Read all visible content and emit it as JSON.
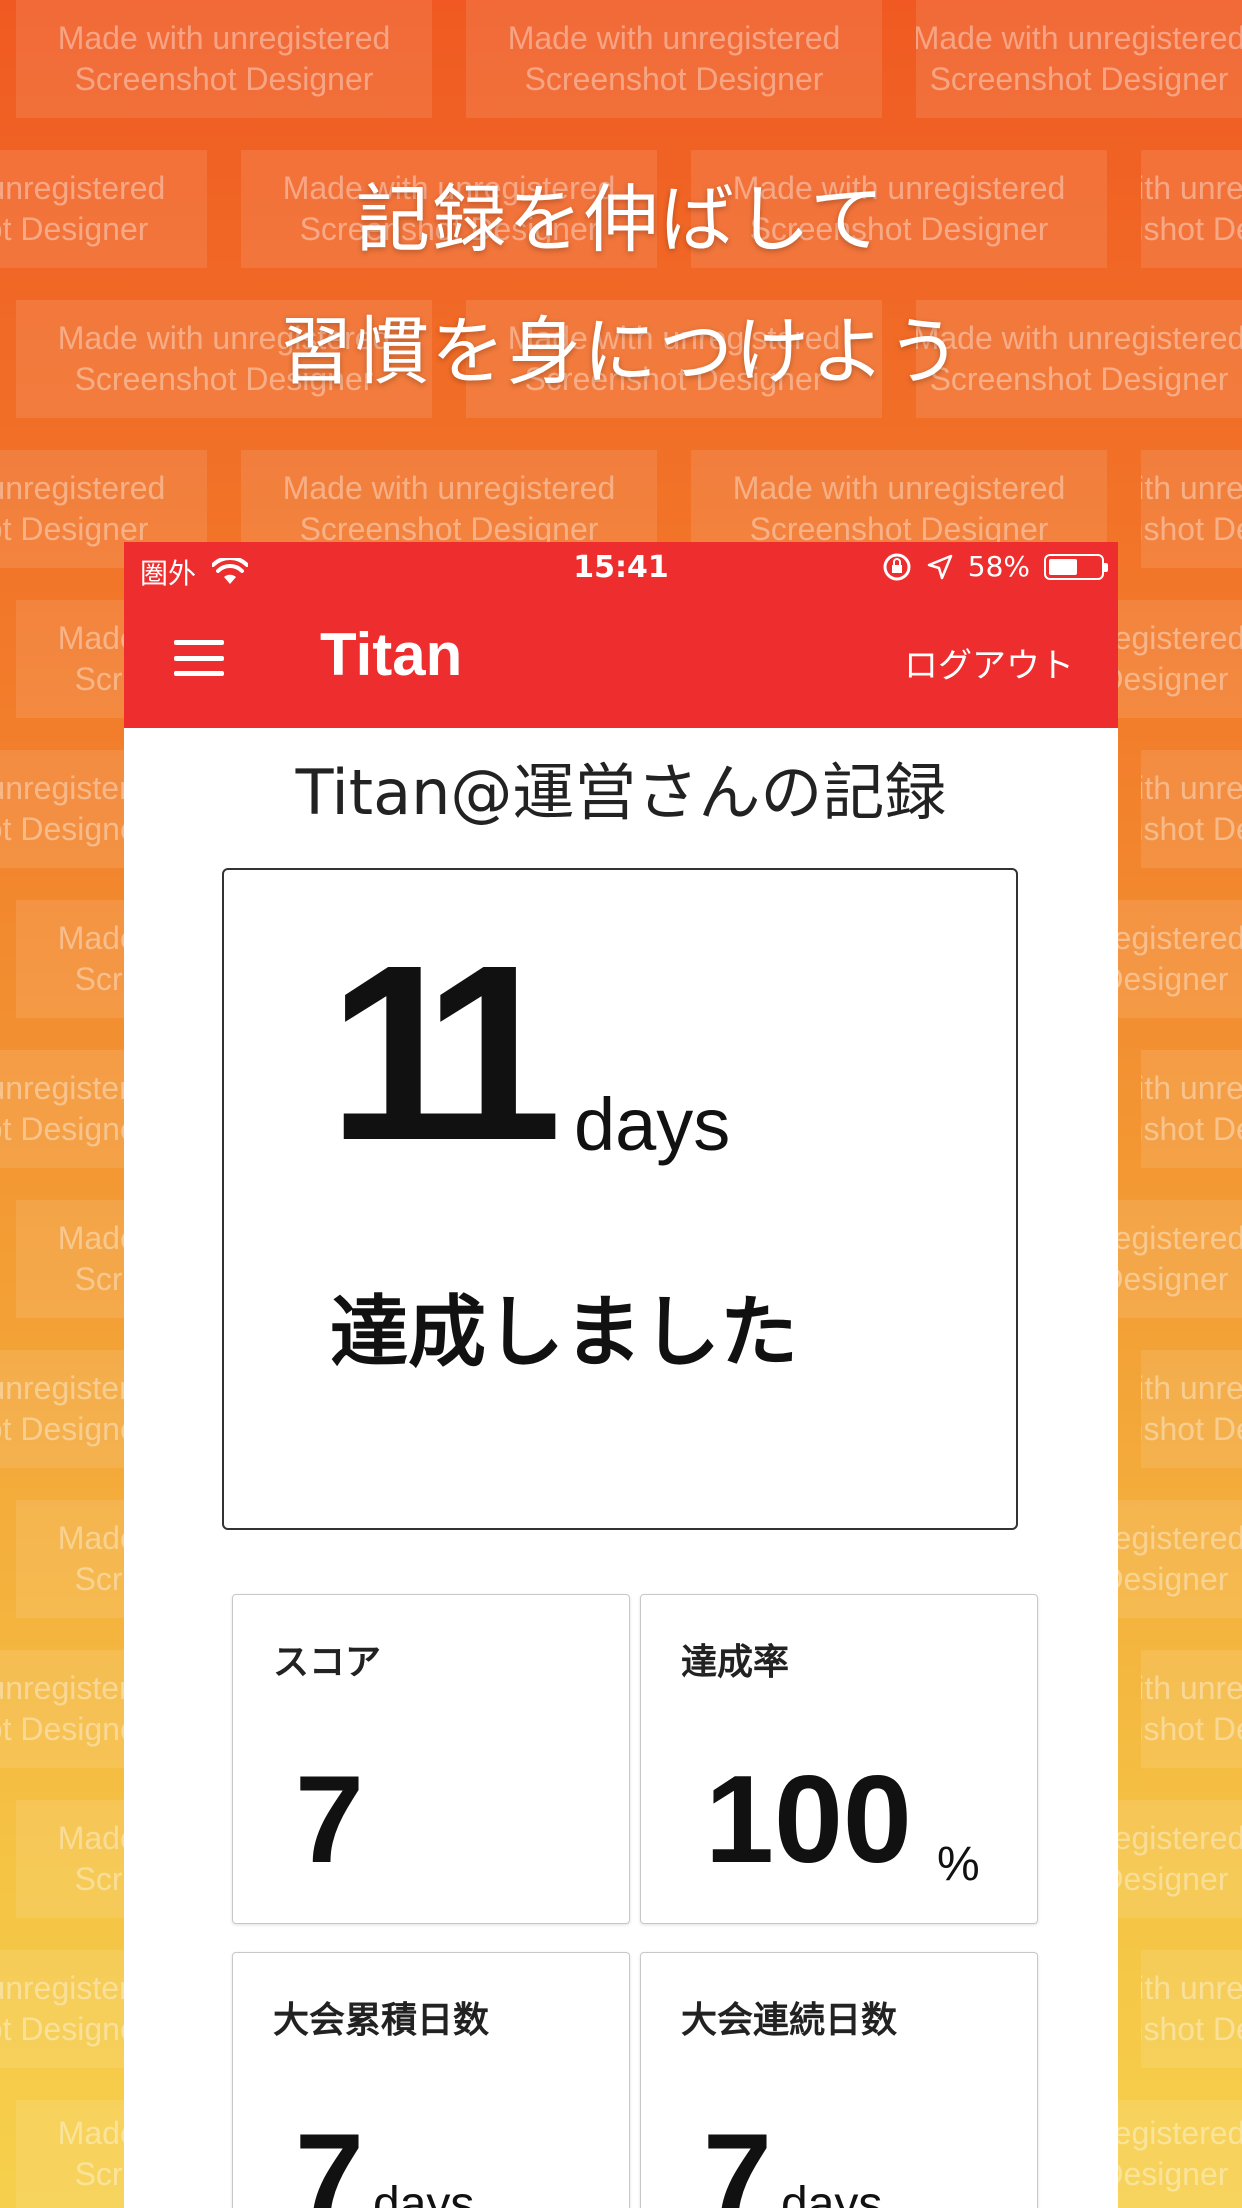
{
  "watermark": {
    "line1": "Made with unregistered",
    "line2": "Screenshot Designer"
  },
  "headline": {
    "line1": "記録を伸ばして",
    "line2": "習慣を身につけよう"
  },
  "status_bar": {
    "carrier": "圏外",
    "time": "15:41",
    "battery_percent": "58%",
    "battery_level": 0.58
  },
  "navbar": {
    "brand": "Titan",
    "logout_label": "ログアウト",
    "color": "#ed2d2e"
  },
  "record": {
    "title": "Titan@運営さんの記録",
    "streak_value": "11",
    "streak_unit": "days",
    "achieved_label": "達成しました"
  },
  "stats": [
    {
      "label": "スコア",
      "value": "7",
      "suffix": ""
    },
    {
      "label": "達成率",
      "value": "100",
      "suffix": "%"
    },
    {
      "label": "大会累積日数",
      "value": "7",
      "suffix": "days"
    },
    {
      "label": "大会連続日数",
      "value": "7",
      "suffix": "days"
    }
  ]
}
